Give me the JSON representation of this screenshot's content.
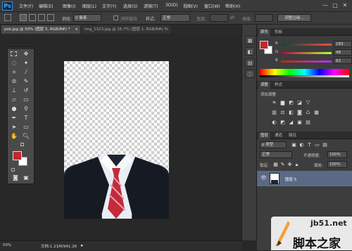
{
  "app": {
    "logo": "Ps"
  },
  "menu": [
    "文件(F)",
    "编辑(E)",
    "图像(I)",
    "图层(L)",
    "文字(Y)",
    "选择(S)",
    "滤镜(T)",
    "3D(D)",
    "视图(V)",
    "窗口(W)",
    "帮助(H)"
  ],
  "window_controls": [
    "—",
    "□",
    "✕"
  ],
  "options": {
    "feather_label": "羽化:",
    "feather_value": "0 像素",
    "antialias_label": "消除锯齿",
    "style_label": "样式:",
    "style_value": "正常",
    "width_label": "宽度:",
    "height_label": "高度:",
    "refine_button": "调整边缘..."
  },
  "tabs": [
    {
      "label": "psb.jpg @ 50% (图层 5, RGB/8#) *",
      "close": "×"
    },
    {
      "label": "img_1323.jpg @ 16.7% (图层 1, RGB/8#) *",
      "close": "×"
    }
  ],
  "status": {
    "zoom": "50%",
    "doc": "文档:1.21M/941.2K"
  },
  "color_panel": {
    "tabs": [
      "颜色",
      "色板"
    ],
    "fg_color": "#c0282e",
    "channels": [
      {
        "label": "R",
        "value": "183"
      },
      {
        "label": "G",
        "value": "48"
      },
      {
        "label": "B",
        "value": "62"
      }
    ]
  },
  "adjust_panel": {
    "tabs": [
      "调整",
      "样式"
    ],
    "title": "添加调整"
  },
  "layers_panel": {
    "tabs": [
      "图层",
      "通道",
      "路径"
    ],
    "kind_label": "ρ 类型",
    "blend_mode": "正常",
    "opacity_label": "不透明度:",
    "opacity_value": "100%",
    "lock_label": "锁定:",
    "fill_label": "填充:",
    "fill_value": "100%",
    "layer_name": "图层 5"
  },
  "watermark": {
    "site": "jb51.net",
    "name": "脚本之家"
  }
}
